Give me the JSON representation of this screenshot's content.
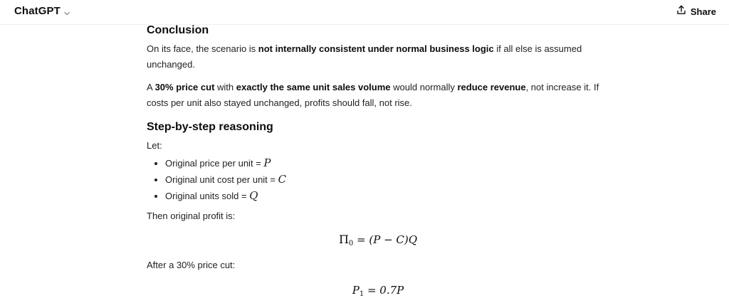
{
  "header": {
    "app_title": "ChatGPT",
    "title_chevron_icon": "chevron-down-icon",
    "share_label": "Share",
    "share_icon": "share-upload-icon"
  },
  "message": {
    "conclusion_heading": "Conclusion",
    "p1": {
      "a": "On its face, the scenario is ",
      "b": "not internally consistent under normal business logic",
      "c": " if all else is assumed unchanged."
    },
    "p2": {
      "a": "A ",
      "b": "30% price cut",
      "c": " with ",
      "d": "exactly the same unit sales volume",
      "e": " would normally ",
      "f": "reduce revenue",
      "g": ", not increase it. If costs per unit also stayed unchanged, profits should fall, not rise."
    },
    "reasoning_heading": "Step-by-step reasoning",
    "let_label": "Let:",
    "bullets": [
      {
        "text": "Original price per unit = ",
        "var": "P"
      },
      {
        "text": "Original unit cost per unit = ",
        "var": "C"
      },
      {
        "text": "Original units sold = ",
        "var": "Q"
      }
    ],
    "profit_intro": "Then original profit is:",
    "eq1": {
      "lhs": "Π",
      "lhs_sub": "0",
      "rhs": " = (P − C)Q"
    },
    "after_cut": "After a 30% price cut:",
    "eq2": {
      "lhs": "P",
      "lhs_sub": "1",
      "rhs": " = 0.7P"
    }
  }
}
